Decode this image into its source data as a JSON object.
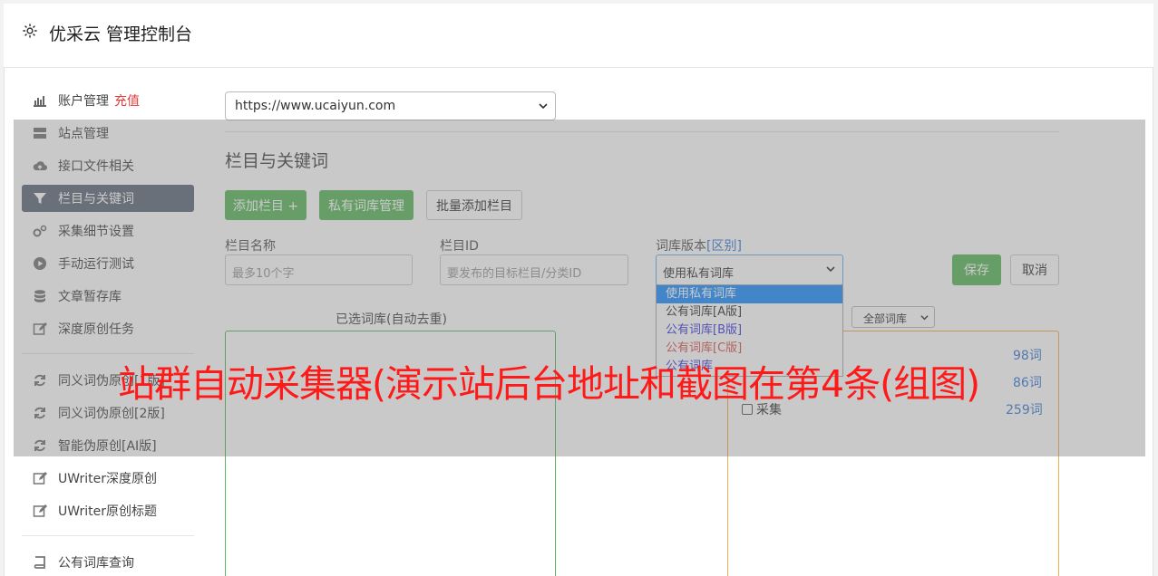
{
  "app": {
    "title": "优采云 管理控制台"
  },
  "sidebar": {
    "items": [
      {
        "label": "账户管理",
        "badge": "充值",
        "icon": "bar-chart-icon"
      },
      {
        "label": "站点管理",
        "icon": "server-icon"
      },
      {
        "label": "接口文件相关",
        "icon": "cloud-upload-icon"
      },
      {
        "label": "栏目与关键词",
        "icon": "filter-icon",
        "active": true
      },
      {
        "label": "采集细节设置",
        "icon": "gears-icon"
      },
      {
        "label": "手动运行测试",
        "icon": "play-icon"
      },
      {
        "label": "文章暂存库",
        "icon": "database-icon"
      },
      {
        "label": "深度原创任务",
        "icon": "edit-icon"
      }
    ],
    "items2": [
      {
        "label": "同义词伪原创[1版]",
        "icon": "refresh-icon"
      },
      {
        "label": "同义词伪原创[2版]",
        "icon": "refresh-icon"
      },
      {
        "label": "智能伪原创[AI版]",
        "icon": "refresh-icon"
      },
      {
        "label": "UWriter深度原创",
        "icon": "edit-icon"
      },
      {
        "label": "UWriter原创标题",
        "icon": "edit-icon"
      }
    ],
    "items3": [
      {
        "label": "公有词库查询",
        "icon": "book-icon"
      }
    ]
  },
  "main": {
    "site_select": "https://www.ucaiyun.com",
    "section_title": "栏目与关键词",
    "buttons": {
      "add": "添加栏目 +",
      "private": "私有词库管理",
      "batch": "批量添加栏目"
    },
    "form": {
      "name_label": "栏目名称",
      "name_placeholder": "最多10个字",
      "id_label": "栏目ID",
      "id_placeholder": "要发布的目标栏目/分类ID",
      "version_label": "词库版本",
      "version_link": "[区别]",
      "version_value": "使用私有词库",
      "save": "保存",
      "cancel": "取消"
    },
    "dropdown": [
      "使用私有词库",
      "公有词库[A版]",
      "公有词库[B版]",
      "公有词库[C版]",
      "公有词库"
    ],
    "left_panel_title": "已选词库(自动去重)",
    "right_select": "全部词库",
    "libraries": [
      {
        "name": "",
        "count": "98词"
      },
      {
        "name": "",
        "count": "86词"
      },
      {
        "name": "采集",
        "count": "259词"
      }
    ]
  },
  "banner": "站群自动采集器(演示站后台地址和截图在第4条(组图)"
}
